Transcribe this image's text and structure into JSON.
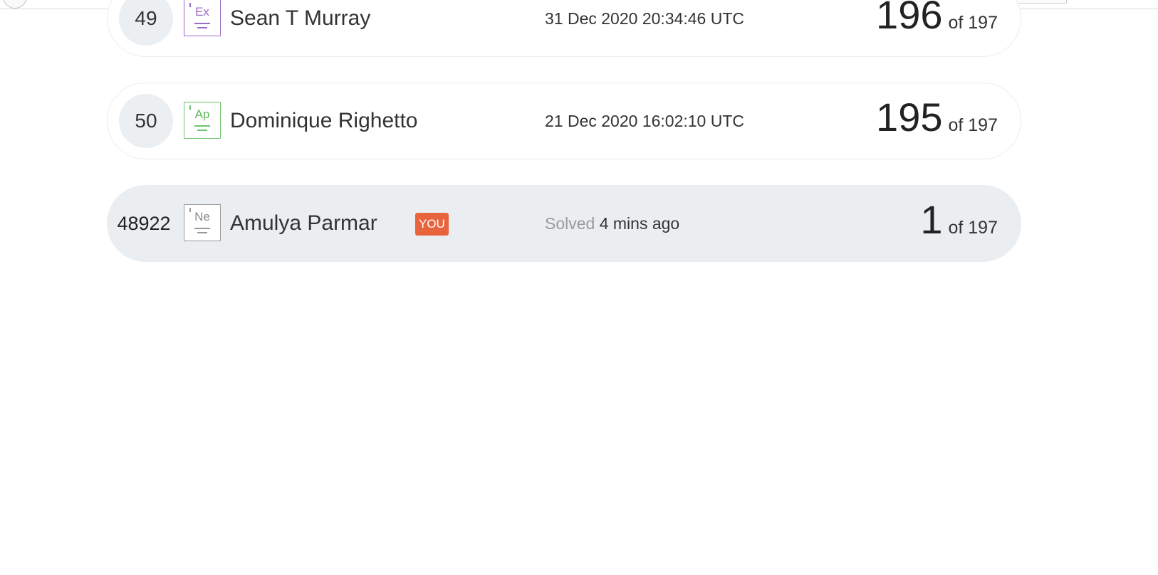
{
  "leaderboard": {
    "rows": [
      {
        "rank": "49",
        "badge_symbol": "Ex",
        "badge_color": "#9b6bc4",
        "name": "Sean T Murray",
        "timestamp": "31 Dec 2020 20:34:46 UTC",
        "score": "196",
        "score_suffix": "of 197"
      },
      {
        "rank": "50",
        "badge_symbol": "Ap",
        "badge_color": "#6ec46c",
        "name": "Dominique Righetto",
        "timestamp": "21 Dec 2020 16:02:10 UTC",
        "score": "195",
        "score_suffix": "of 197"
      }
    ],
    "current_user": {
      "rank": "48922",
      "badge_symbol": "Ne",
      "badge_color": "#9a9a9a",
      "name": "Amulya Parmar",
      "you_label": "YOU",
      "you_color": "#e8643c",
      "solved_prefix": "Solved",
      "solved_time": "4 mins ago",
      "score": "1",
      "score_suffix": "of 197",
      "row_background": "#eaeef1"
    }
  }
}
